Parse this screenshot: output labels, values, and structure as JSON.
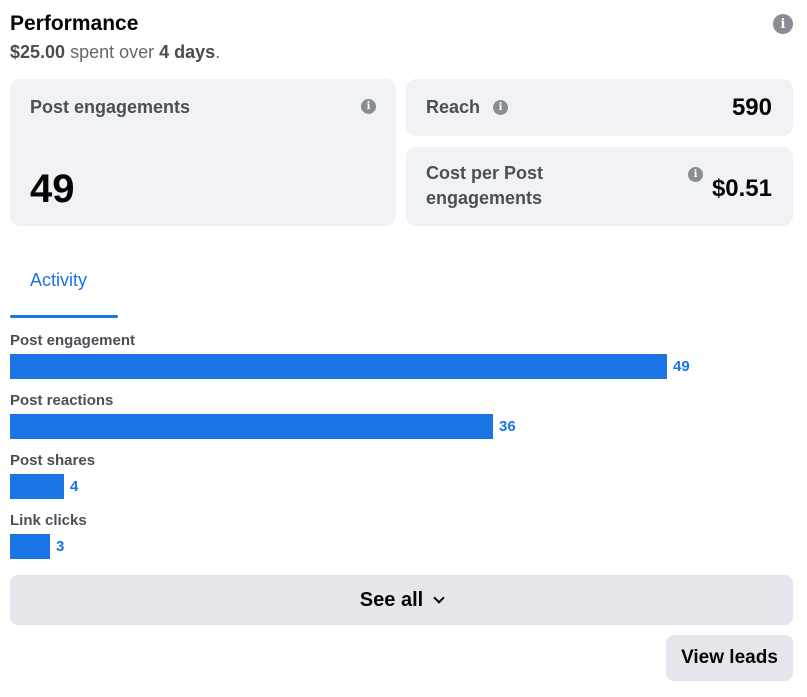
{
  "header": {
    "title": "Performance",
    "spent_amount": "$25.00",
    "spent_text": "spent over",
    "days": "4 days",
    "period_end": "."
  },
  "cards": {
    "post_engagements": {
      "label": "Post engagements",
      "value": "49"
    },
    "reach": {
      "label": "Reach",
      "value": "590"
    },
    "cost_per": {
      "label": "Cost per Post engagements",
      "value": "$0.51"
    }
  },
  "tabs": [
    {
      "label": "Activity",
      "active": true
    }
  ],
  "activity": {
    "max": 49,
    "rows": [
      {
        "label": "Post engagement",
        "value": 49
      },
      {
        "label": "Post reactions",
        "value": 36
      },
      {
        "label": "Post shares",
        "value": 4
      },
      {
        "label": "Link clicks",
        "value": 3
      }
    ]
  },
  "actions": {
    "see_all": "See all",
    "view_leads": "View leads"
  },
  "colors": {
    "accent": "#1b74e4",
    "card_bg": "#f0f2f5",
    "button_bg": "#e4e6eb"
  },
  "icons": {
    "info": "info-icon",
    "expand": "chevron-down-icon"
  }
}
